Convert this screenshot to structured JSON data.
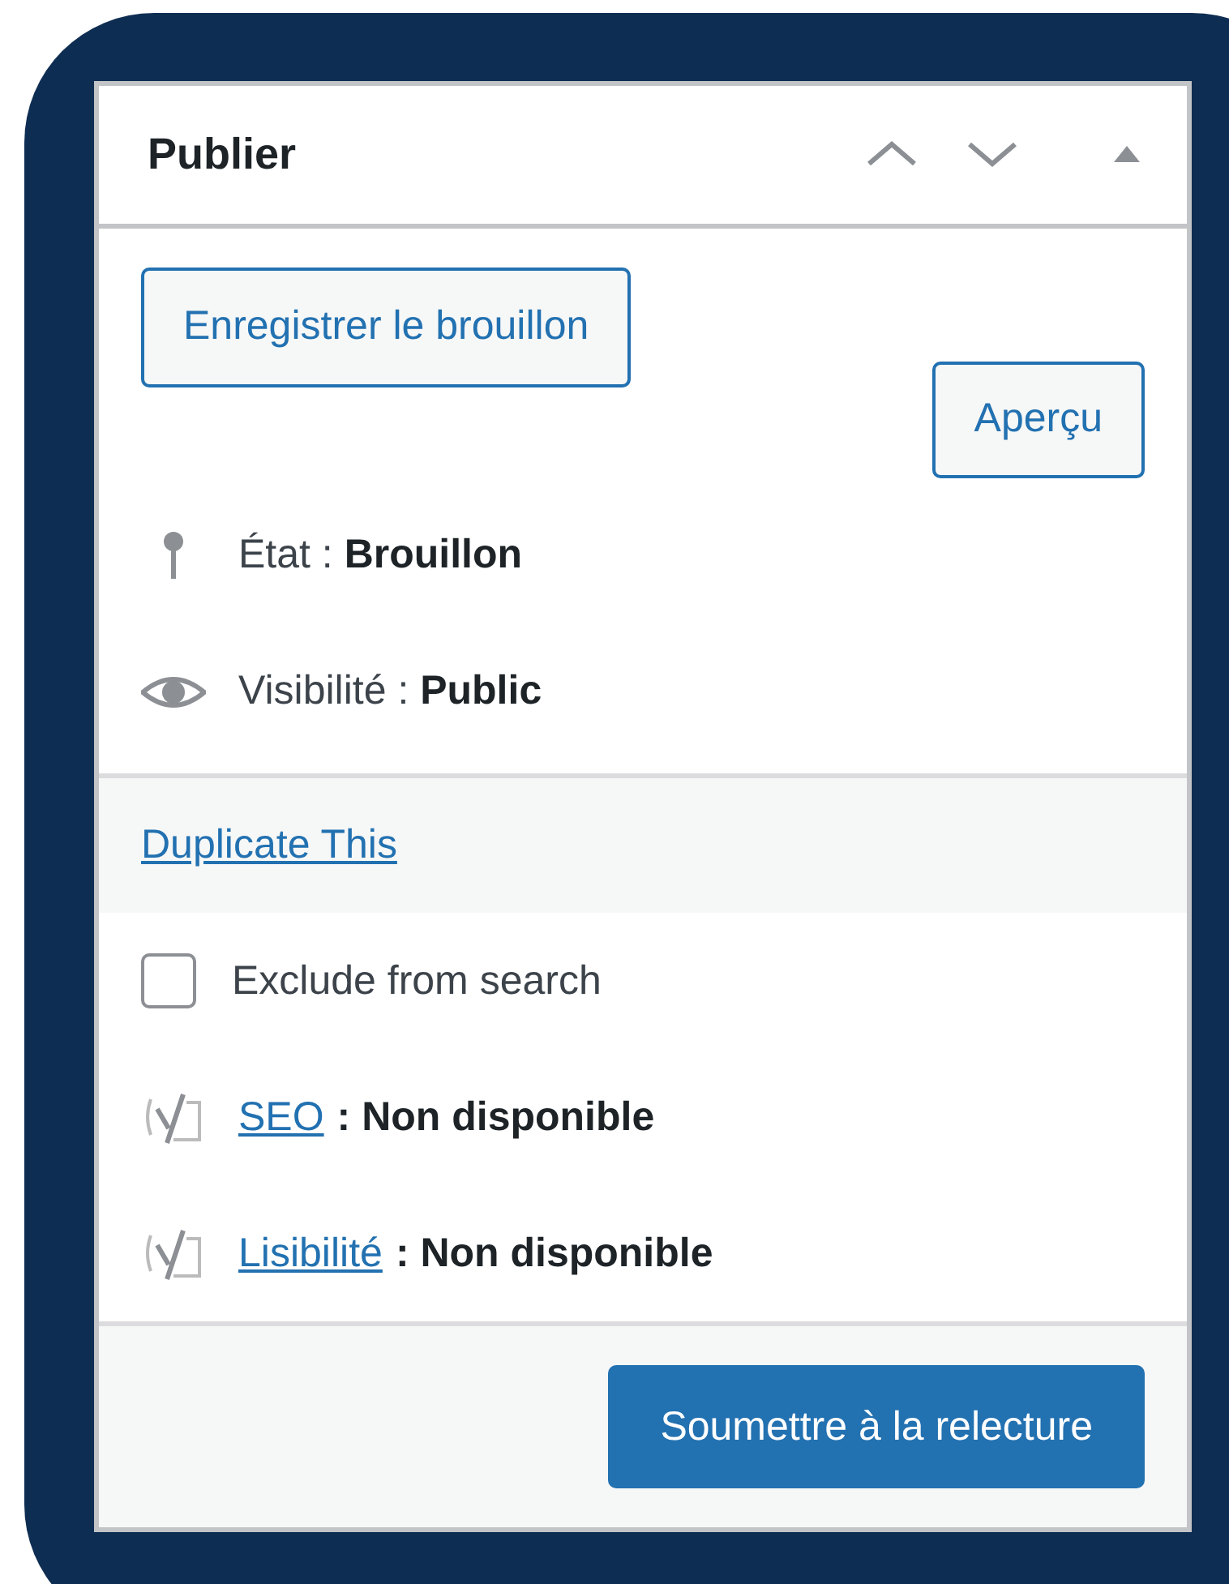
{
  "panel": {
    "title": "Publier"
  },
  "actions": [
    {
      "label": "Enregistrer le brouillon"
    },
    {
      "label": "Aperçu"
    }
  ],
  "status": [
    {
      "kind": "state",
      "text": "État : **Brouillon**"
    },
    {
      "kind": "visibility",
      "text": "Visibilité : **Public**"
    }
  ],
  "duplicate_link": "Duplicate This",
  "exclude_search": {
    "label": "Exclude from search",
    "checked": false
  },
  "seo": [
    {
      "link": "SEO",
      "value": ": Non disponible"
    },
    {
      "link": "Lisibilité",
      "value": ": Non disponible"
    }
  ],
  "submit": "Soumettre à la relecture"
}
